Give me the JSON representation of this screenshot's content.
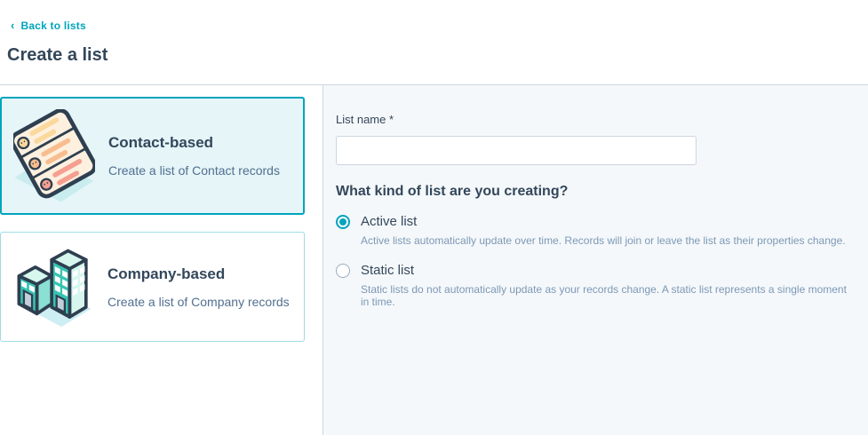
{
  "page": {
    "back_chevron": "‹",
    "back_label": "Back to lists",
    "title": "Create a list"
  },
  "cards": [
    {
      "title": "Contact-based",
      "description": "Create a list of Contact records",
      "selected": true
    },
    {
      "title": "Company-based",
      "description": "Create a list of Company records",
      "selected": false
    }
  ],
  "form": {
    "list_name_label": "List name *",
    "list_name_value": "",
    "question": "What kind of list are you creating?",
    "options": [
      {
        "label": "Active list",
        "description": "Active lists automatically update over time. Records will join or leave the list as their properties change.",
        "selected": true
      },
      {
        "label": "Static list",
        "description": "Static lists do not automatically update as your records change. A static list represents a single moment in time.",
        "selected": false
      }
    ]
  },
  "icons": {
    "contact_card": "contact-list-illustration",
    "company_card": "company-buildings-illustration"
  },
  "colors": {
    "accent_teal": "#00a4bd",
    "heading_text": "#33475b",
    "muted_text": "#516f90",
    "border_gray": "#cbd6e2",
    "panel_background": "#f5f8fa",
    "selected_card_background": "#e5f5f8"
  }
}
